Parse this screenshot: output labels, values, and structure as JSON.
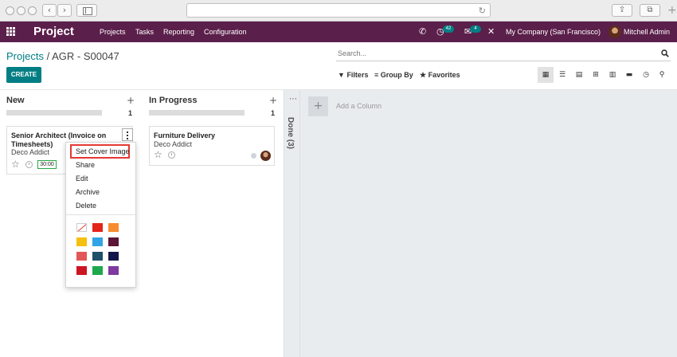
{
  "navbar": {
    "app_name": "Project",
    "menu": [
      "Projects",
      "Tasks",
      "Reporting",
      "Configuration"
    ],
    "activity_count": "42",
    "message_count": "4",
    "company": "My Company (San Francisco)",
    "user": "Mitchell Admin"
  },
  "breadcrumb": {
    "parent": "Projects",
    "separator": "/",
    "current": "AGR - S00047"
  },
  "search": {
    "placeholder": "Search..."
  },
  "toolbar": {
    "create_label": "CREATE",
    "filters_label": "Filters",
    "group_by_label": "Group By",
    "favorites_label": "Favorites"
  },
  "columns": [
    {
      "title": "New",
      "count": "1"
    },
    {
      "title": "In Progress",
      "count": "1"
    }
  ],
  "folded_column": {
    "label": "Done (3)"
  },
  "add_column": {
    "label": "Add a Column"
  },
  "cards": [
    {
      "title": "Senior Architect (Invoice on Timesheets)",
      "customer": "Deco Addict",
      "time": "30:00"
    },
    {
      "title": "Furniture Delivery",
      "customer": "Deco Addict"
    }
  ],
  "dropdown": {
    "items": [
      "Set Cover Image",
      "Share",
      "Edit",
      "Archive",
      "Delete"
    ],
    "colors": [
      "none",
      "#e4241b",
      "#f88b30",
      "#f5c00f",
      "#30a4e5",
      "#5b1537",
      "#e35557",
      "#1e4f6b",
      "#14164a",
      "#cc1422",
      "#1ea84d",
      "#7e3aa1"
    ]
  },
  "accent_color": "#017e84",
  "navbar_color": "#5b1f4b"
}
